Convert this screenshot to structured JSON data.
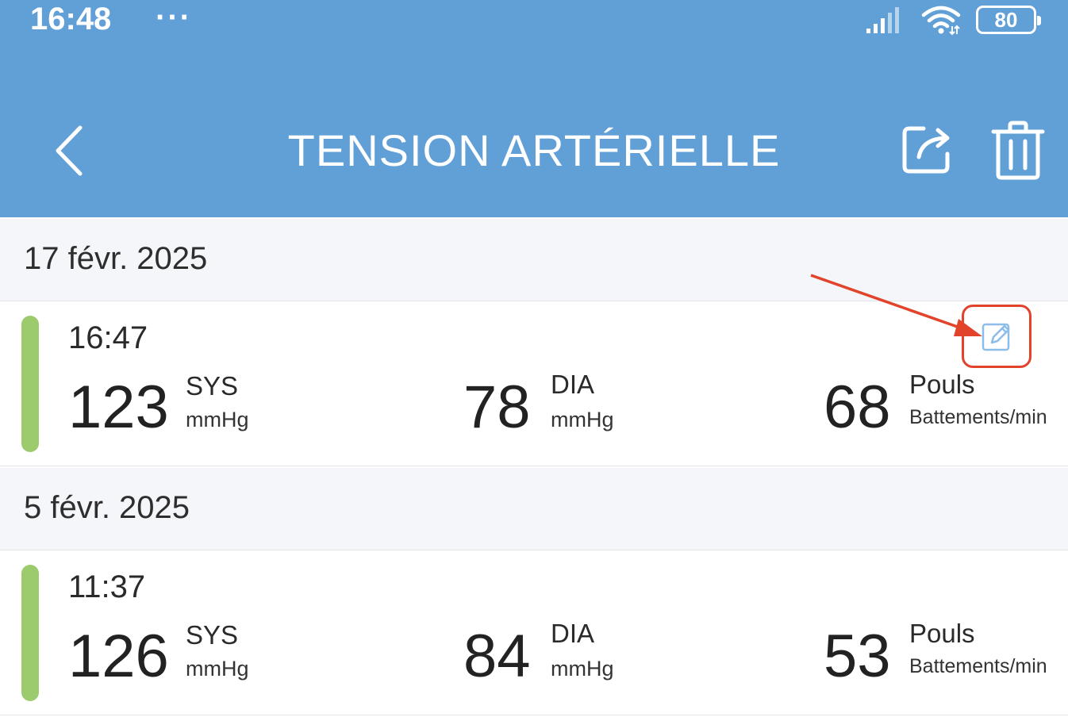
{
  "status_bar": {
    "time": "16:48",
    "dots": "···",
    "battery": "80"
  },
  "header": {
    "title": "TENSION ARTÉRIELLE"
  },
  "groups": [
    {
      "date": "17 févr. 2025",
      "record": {
        "time": "16:47",
        "sys": "123",
        "dia": "78",
        "pulse": "68"
      }
    },
    {
      "date": "5 févr. 2025",
      "record": {
        "time": "11:37",
        "sys": "126",
        "dia": "84",
        "pulse": "53"
      }
    }
  ],
  "labels": {
    "sys": "SYS",
    "dia": "DIA",
    "pulse": "Pouls",
    "mmhg": "mmHg",
    "bpm": "Battements/min"
  },
  "colors": {
    "appbar": "#619fd7",
    "status_normal": "#9ccb6e",
    "annotation": "#e2432b"
  },
  "icons": {
    "back": "chevron-left",
    "share": "share-box",
    "delete": "trash",
    "edit": "pencil-square"
  }
}
